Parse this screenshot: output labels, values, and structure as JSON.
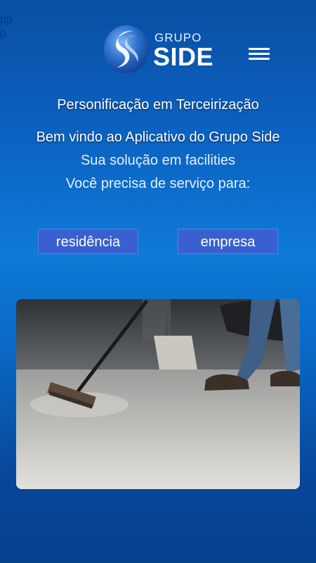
{
  "app": {
    "ghost_text": "pp\np"
  },
  "header": {
    "logo_small": "GRUPO",
    "logo_big": "SIDE",
    "menu_icon": "hamburger-menu-icon"
  },
  "content": {
    "tagline": "Personificação em Terceirização",
    "welcome": "Bem vindo ao Aplicativo do Grupo Side",
    "subtitle": "Sua solução em facilities",
    "question": "Você precisa de serviço para:"
  },
  "choices": {
    "residence_label": "residência",
    "company_label": "empresa"
  },
  "colors": {
    "background_top": "#0a4fa3",
    "background_mid": "#0e7ad6",
    "background_bottom": "#063f8c",
    "button_fill": "#3a5fd0",
    "text": "#ffffff"
  }
}
